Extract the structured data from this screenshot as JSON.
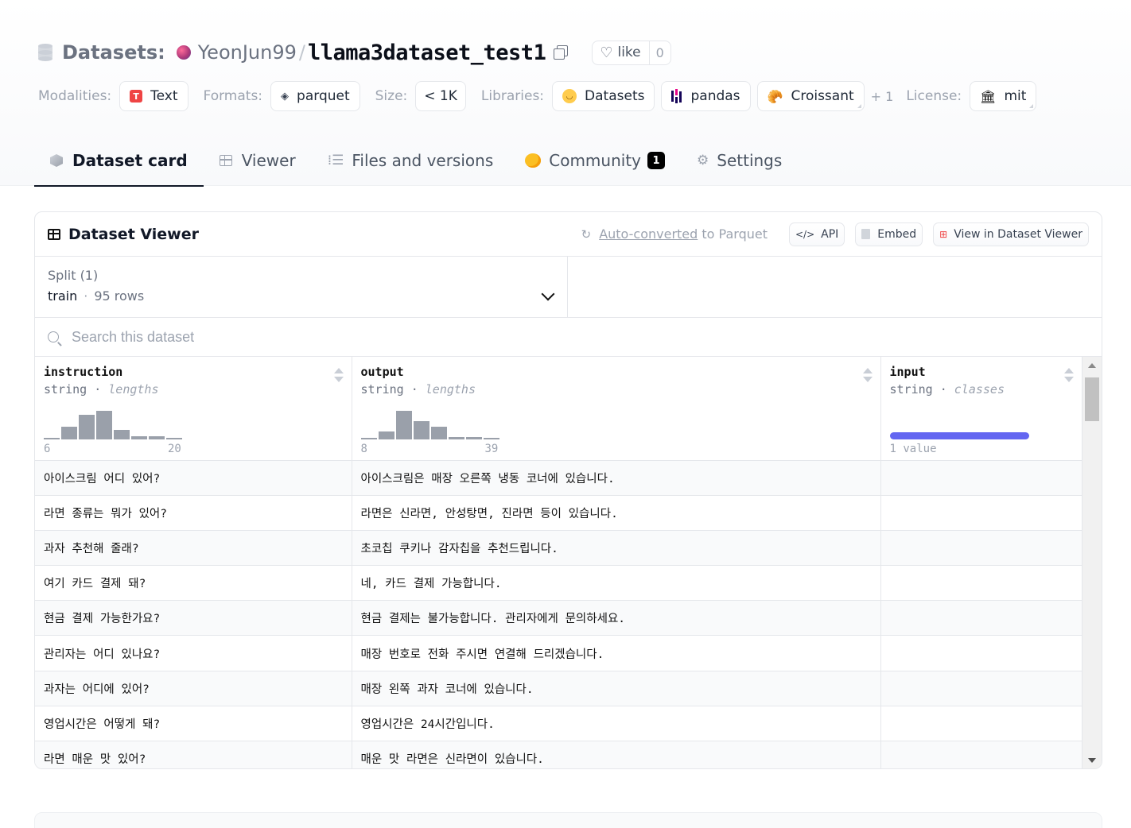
{
  "header": {
    "prefix": "Datasets:",
    "user": "YeonJun99",
    "slash": "/",
    "repo": "llama3dataset_test1",
    "like_label": "like",
    "like_count": "0"
  },
  "meta": {
    "modalities_label": "Modalities:",
    "modality": "Text",
    "modality_icon_letter": "T",
    "formats_label": "Formats:",
    "format": "parquet",
    "size_label": "Size:",
    "size": "< 1K",
    "libraries_label": "Libraries:",
    "libraries": [
      "Datasets",
      "pandas",
      "Croissant"
    ],
    "more_libraries": "+ 1",
    "license_label": "License:",
    "license": "mit"
  },
  "tabs": [
    {
      "label": "Dataset card",
      "icon": "cube-icon",
      "active": true
    },
    {
      "label": "Viewer",
      "icon": "table-icon"
    },
    {
      "label": "Files and versions",
      "icon": "files-icon"
    },
    {
      "label": "Community",
      "icon": "community-icon",
      "badge": "1"
    },
    {
      "label": "Settings",
      "icon": "gear-icon"
    }
  ],
  "viewer": {
    "title": "Dataset Viewer",
    "auto_converted_link": "Auto-converted",
    "auto_converted_rest": " to Parquet",
    "api_label": "API",
    "embed_label": "Embed",
    "view_label": "View in Dataset Viewer",
    "split_label": "Split (1)",
    "split_name": "train",
    "split_dot": "·",
    "split_rows": "95 rows",
    "search_placeholder": "Search this dataset",
    "columns": [
      {
        "name": "instruction",
        "type": "string",
        "stat": "lengths",
        "min": "6",
        "max": "20",
        "hist": [
          4,
          40,
          80,
          92,
          30,
          10,
          10,
          4
        ]
      },
      {
        "name": "output",
        "type": "string",
        "stat": "lengths",
        "min": "8",
        "max": "39",
        "hist": [
          4,
          26,
          92,
          58,
          40,
          8,
          8,
          4
        ]
      },
      {
        "name": "input",
        "type": "string",
        "stat": "classes",
        "summary": "1 value"
      }
    ],
    "rows": [
      [
        "아이스크림 어디 있어?",
        "아이스크림은 매장 오른쪽 냉동 코너에 있습니다.",
        ""
      ],
      [
        "라면 종류는 뭐가 있어?",
        "라면은 신라면, 안성탕면, 진라면 등이 있습니다.",
        ""
      ],
      [
        "과자 추천해 줄래?",
        "초코칩 쿠키나 감자칩을 추천드립니다.",
        ""
      ],
      [
        "여기 카드 결제 돼?",
        "네, 카드 결제 가능합니다.",
        ""
      ],
      [
        "현금 결제 가능한가요?",
        "현금 결제는 불가능합니다. 관리자에게 문의하세요.",
        ""
      ],
      [
        "관리자는 어디 있나요?",
        "매장 번호로 전화 주시면 연결해 드리겠습니다.",
        ""
      ],
      [
        "과자는 어디에 있어?",
        "매장 왼쪽 과자 코너에 있습니다.",
        ""
      ],
      [
        "영업시간은 어떻게 돼?",
        "영업시간은 24시간입니다.",
        ""
      ],
      [
        "라면 매운 맛 있어?",
        "매운 맛 라면은 신라면이 있습니다.",
        ""
      ]
    ]
  }
}
